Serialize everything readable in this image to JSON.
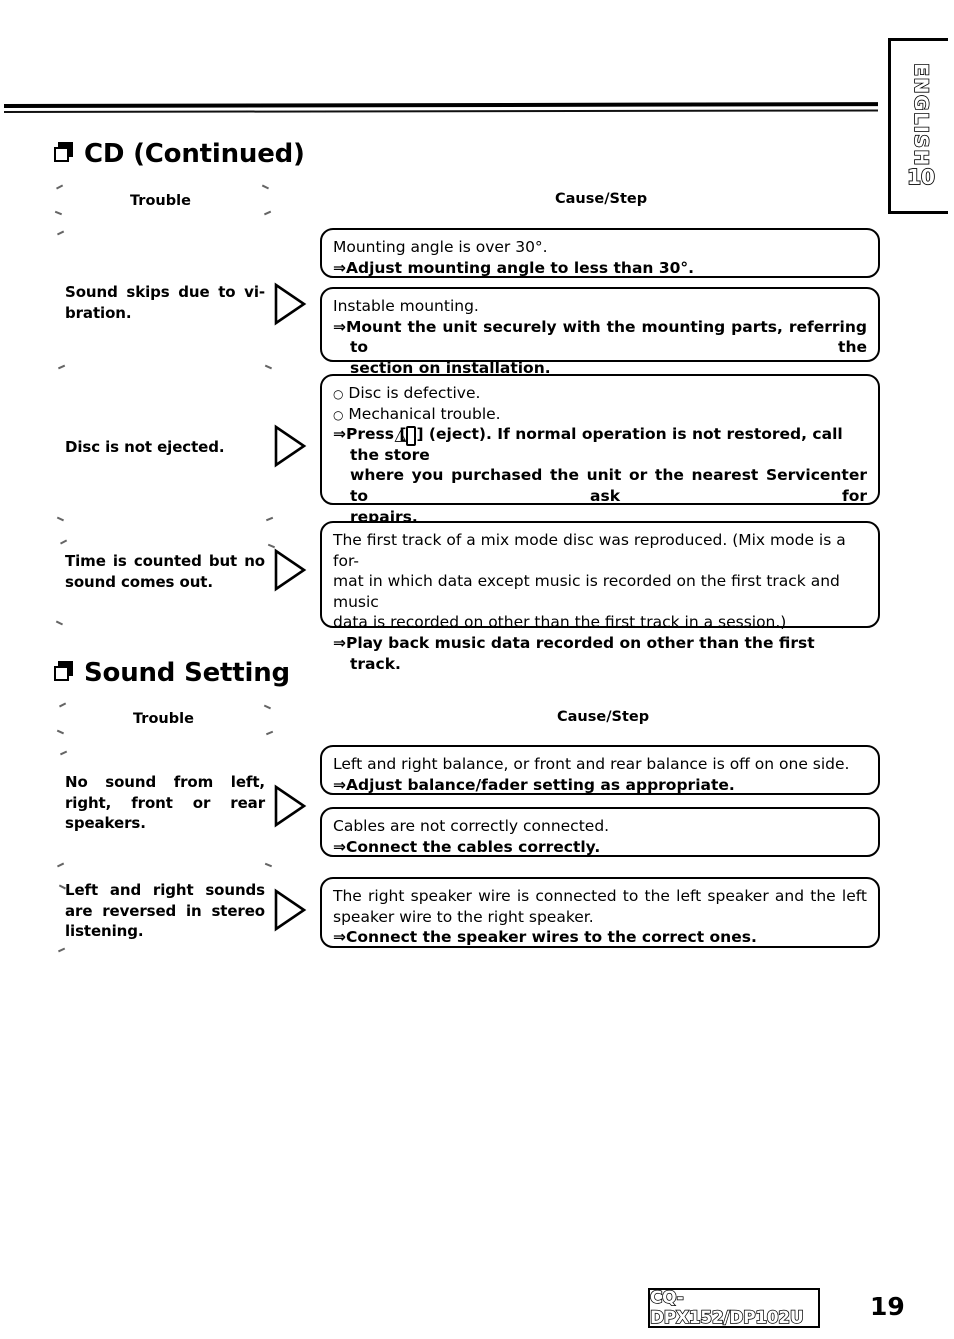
{
  "document": {
    "language_tab": {
      "label": "ENGLISH",
      "number": "10"
    },
    "footer": {
      "model": "CQ-DPX152/DP102U",
      "page_number": "19"
    }
  },
  "sections": [
    {
      "id": "cd-continued",
      "title": "CD (Continued)",
      "columns": {
        "trouble": "Trouble",
        "cause_step": "Cause/Step"
      },
      "rows": [
        {
          "trouble_line1": "Sound  skips  due  to  vi-",
          "trouble_line2": "bration.",
          "boxes": [
            {
              "cause": "Mounting angle is over 30°.",
              "step": "⇒Adjust mounting angle to less than 30°."
            },
            {
              "cause": "Instable mounting.",
              "step_line1": "⇒Mount  the  unit  securely  with  the  mounting  parts,  referring  to  the",
              "step_line2": "section on installation."
            }
          ]
        },
        {
          "trouble_line1": "Disc is not ejected.",
          "boxes": [
            {
              "bullet1": "Disc is defective.",
              "bullet2": "Mechanical trouble.",
              "step_line1_a": "⇒Press [",
              "step_eject_glyph": "△",
              "step_line1_b": "] (eject). If normal operation is not restored, call the store",
              "step_line2": "where  you  purchased  the  unit  or  the  nearest  Servicenter  to  ask  for",
              "step_line3": "repairs."
            }
          ]
        },
        {
          "trouble_line1": "Time  is  counted  but  no",
          "trouble_line2": "sound comes out.",
          "boxes": [
            {
              "cause_line1": "The first track of a mix mode disc was reproduced. (Mix mode is a for-",
              "cause_line2": "mat in which data except music is recorded on the first track and music",
              "cause_line3": "data is recorded on other than the first track in a session.)",
              "step": "⇒Play back music data recorded on other than the first track."
            }
          ]
        }
      ]
    },
    {
      "id": "sound-setting",
      "title": "Sound Setting",
      "columns": {
        "trouble": "Trouble",
        "cause_step": "Cause/Step"
      },
      "rows": [
        {
          "trouble_line1": "No   sound   from   left,",
          "trouble_line2": "right,   front   or   rear",
          "trouble_line3": "speakers.",
          "boxes": [
            {
              "cause": "Left and right balance, or front and rear balance is off on one side.",
              "step": "⇒Adjust balance/fader setting as appropriate."
            },
            {
              "cause": "Cables are not correctly connected.",
              "step": "⇒Connect the cables correctly."
            }
          ]
        },
        {
          "trouble_line1": "Left  and  right  sounds",
          "trouble_line2": "are  reversed  in  stereo",
          "trouble_line3": "listening.",
          "boxes": [
            {
              "cause_line1": "The  right  speaker  wire  is  connected  to  the  left  speaker  and  the  left",
              "cause_line2": "speaker wire to the right speaker.",
              "step": "⇒Connect the speaker wires to the correct ones."
            }
          ]
        }
      ]
    }
  ]
}
